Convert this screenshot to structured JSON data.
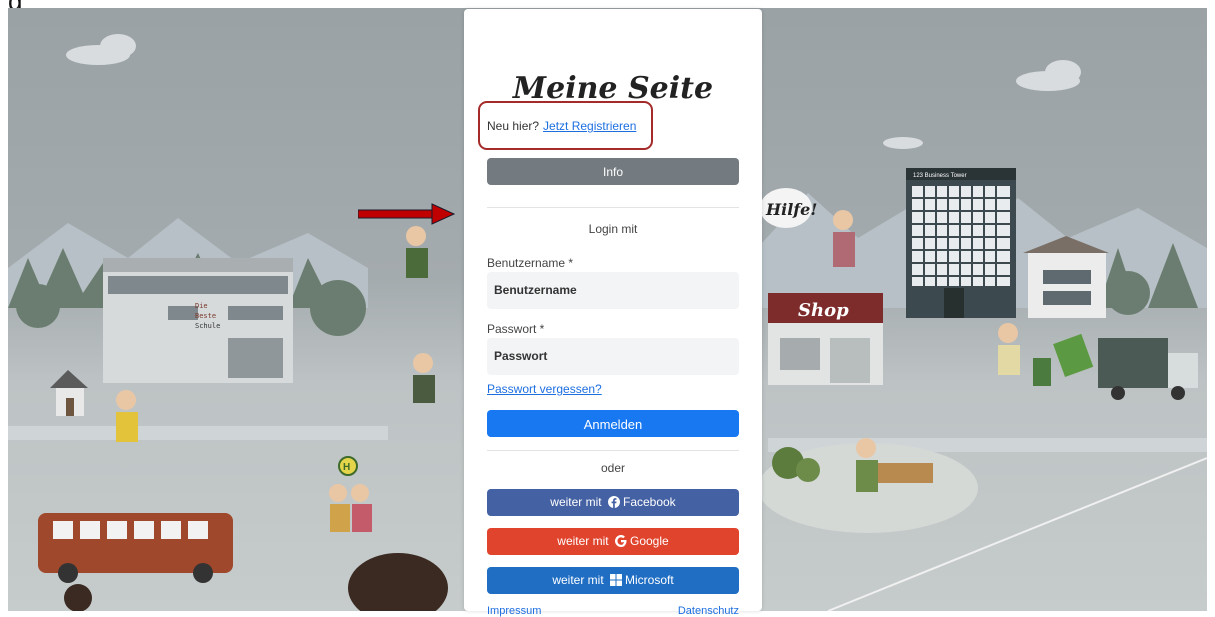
{
  "page": {
    "corner_text": "g"
  },
  "card": {
    "title": "Meine Seite",
    "new_here_text": "Neu hier?",
    "register_link": "Jetzt Registrieren",
    "info_button": "Info",
    "login_with": "Login mit",
    "username_label": "Benutzername *",
    "username_placeholder": "Benutzername",
    "password_label": "Passwort *",
    "password_placeholder": "Passwort",
    "forgot_password": "Passwort vergessen?",
    "login_button": "Anmelden",
    "or_text": "oder",
    "facebook_prefix": "weiter mit",
    "facebook_name": "Facebook",
    "google_prefix": "weiter mit",
    "google_name": "Google",
    "microsoft_prefix": "weiter mit",
    "microsoft_name": "Microsoft",
    "footer_left": "Impressum",
    "footer_right": "Datenschutz"
  },
  "background": {
    "school_sign": [
      "Die",
      "Beste",
      "Schule"
    ],
    "tower_sign": "123 Business Tower",
    "shop_sign": "Shop",
    "speech_bubble": "Hilfe!",
    "bus_stop_letter": "H"
  },
  "colors": {
    "annotation_box": "#a52a2a",
    "annotation_arrow": "#c00000",
    "login_button": "#1778f2",
    "facebook": "#4461a3",
    "google": "#e0442d",
    "microsoft": "#1f6ec4",
    "info": "#737a80",
    "link": "#1d6fe0"
  },
  "icons": {
    "facebook": "facebook-icon",
    "google": "google-icon",
    "microsoft": "microsoft-icon",
    "annotation": "arrow-right-icon"
  }
}
